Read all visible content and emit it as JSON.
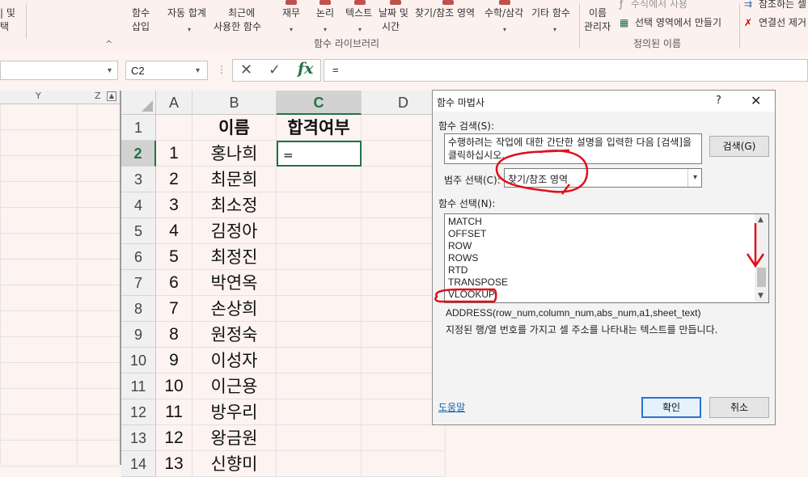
{
  "ribbon": {
    "partial_left": "| 및",
    "partial_left2": "택",
    "insert_func": "함수",
    "insert_func2": "삽입",
    "autosum": "자동 합계",
    "recent": "최근에",
    "recent2": "사용한 함수",
    "financial": "재무",
    "logical": "논리",
    "text": "텍스트",
    "datetime": "날짜 및",
    "datetime2": "시간",
    "lookup": "찾기/참조 영역",
    "math": "수학/삼각",
    "more": "기타 함수",
    "name_mgr": "이름",
    "name_mgr2": "관리자",
    "use_in_formula": "수식에서 사용",
    "create_from_sel": "선택 영역에서 만들기",
    "trace_precedents": "참조하는 셀",
    "remove_arrows": "연결선 제거",
    "group_library": "함수 라이브러리",
    "group_names": "정의된 이름",
    "collapse": "^"
  },
  "formula_bar": {
    "name_box": "C2",
    "formula": "=",
    "fx": "fx",
    "cancel": "✕",
    "enter": "✓",
    "dots": "⋮"
  },
  "left_sheet": {
    "col_y": "Y",
    "col_z": "Z"
  },
  "sheet": {
    "columns": [
      "A",
      "B",
      "C",
      "D"
    ],
    "row_numbers": [
      "1",
      "2",
      "3",
      "4",
      "5",
      "6",
      "7",
      "8",
      "9",
      "10",
      "11",
      "12",
      "13",
      "14"
    ],
    "header_b": "이름",
    "header_c": "합격여부",
    "row_a": [
      "1",
      "2",
      "3",
      "4",
      "5",
      "6",
      "7",
      "8",
      "9",
      "10",
      "11",
      "12",
      "13"
    ],
    "row_b": [
      "홍나희",
      "최문희",
      "최소정",
      "김정아",
      "최정진",
      "박연옥",
      "손상희",
      "원정숙",
      "이성자",
      "이근용",
      "방우리",
      "왕금원",
      "신향미"
    ],
    "active_cell_value": "="
  },
  "dialog": {
    "title": "함수 마법사",
    "help": "?",
    "close": "✕",
    "search_label": "함수 검색(S):",
    "search_text": "수행하려는 작업에 대한 간단한 설명을 입력한 다음 [검색]을 클릭하십시오.",
    "search_btn": "검색(G)",
    "category_label": "범주 선택(C):",
    "category_value": "찾기/참조 영역",
    "func_label": "함수 선택(N):",
    "functions": [
      "MATCH",
      "OFFSET",
      "ROW",
      "ROWS",
      "RTD",
      "TRANSPOSE",
      "VLOOKUP"
    ],
    "signature": "ADDRESS(row_num,column_num,abs_num,a1,sheet_text)",
    "description": "지정된 행/열 번호를 가지고 셀 주소를 나타내는 텍스트를 만듭니다.",
    "help_link": "도움말",
    "ok": "확인",
    "cancel": "취소"
  },
  "colors": {
    "annotation": "#e0101a",
    "accent_green": "#217346",
    "selected_list": "#cce0f5"
  }
}
